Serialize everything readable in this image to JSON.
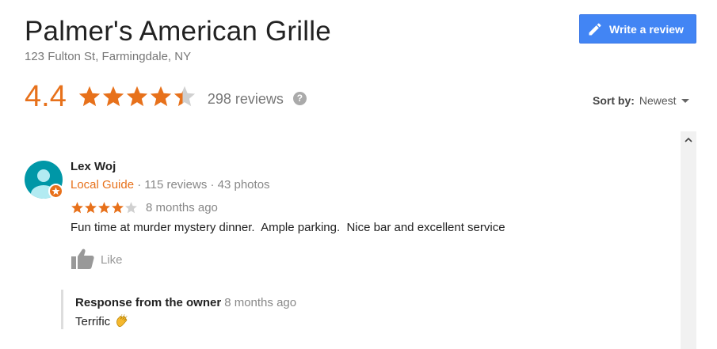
{
  "place": {
    "name": "Palmer's American Grille",
    "address": "123 Fulton St, Farmingdale, NY"
  },
  "actions": {
    "write_review_label": "Write a review",
    "write_review_icon": "pencil-icon"
  },
  "summary": {
    "rating": "4.4",
    "rating_value": 4.4,
    "stars_max": 5,
    "review_count": "298 reviews",
    "help_icon": "question-circle-icon"
  },
  "sort": {
    "label": "Sort by:",
    "value": "Newest"
  },
  "review": {
    "author": "Lex Woj",
    "badge": "Local Guide",
    "meta": " · 115 reviews · 43 photos",
    "stars": 4,
    "stars_max": 5,
    "time": "8 months ago",
    "text": "Fun time at murder mystery dinner.  Ample parking.  Nice bar and excellent service",
    "like_label": "Like",
    "owner_response": {
      "title": "Response from the owner",
      "time": "8 months ago",
      "text": "Terrific",
      "icon": "clapping-hands-icon"
    }
  },
  "colors": {
    "accent": "#e7711b",
    "button_blue": "#4285f4",
    "star_empty": "#d0d0d0",
    "avatar_bg": "#0097a7"
  }
}
